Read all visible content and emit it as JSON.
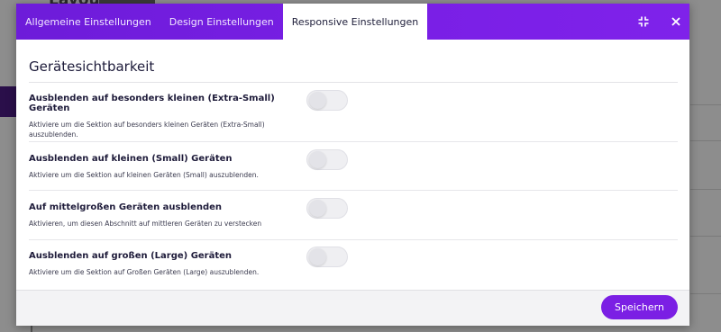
{
  "background": {
    "page_title": "Layout"
  },
  "tabs": [
    {
      "label": "Allgemeine Einstellungen",
      "active": false
    },
    {
      "label": "Design Einstellungen",
      "active": false
    },
    {
      "label": "Responsive Einstellungen",
      "active": true
    }
  ],
  "header_icons": [
    "compress-icon",
    "close-icon"
  ],
  "section": {
    "title": "Gerätesichtbarkeit"
  },
  "settings": [
    {
      "label": "Ausblenden auf besonders kleinen (Extra-Small) Geräten",
      "description": "Aktiviere um die Sektion auf besonders kleinen Geräten (Extra-Small) auszublenden.",
      "enabled": false
    },
    {
      "label": "Ausblenden auf kleinen (Small) Geräten",
      "description": "Aktiviere um die Sektion auf kleinen Geräten (Small) auszublenden.",
      "enabled": false
    },
    {
      "label": "Auf mittelgroßen Geräten ausblenden",
      "description": "Aktivieren, um diesen Abschnitt auf mittleren Geräten zu verstecken",
      "enabled": false
    },
    {
      "label": "Ausblenden auf großen (Large) Geräten",
      "description": "Aktiviere um die Sektion auf Großen Geräten (Large) auszublenden.",
      "enabled": false
    }
  ],
  "footer": {
    "save_label": "Speichern"
  },
  "colors": {
    "accent": "#7b1fe4",
    "header_gradient_start": "#6d1cd9",
    "header_gradient_end": "#7f22ea"
  }
}
